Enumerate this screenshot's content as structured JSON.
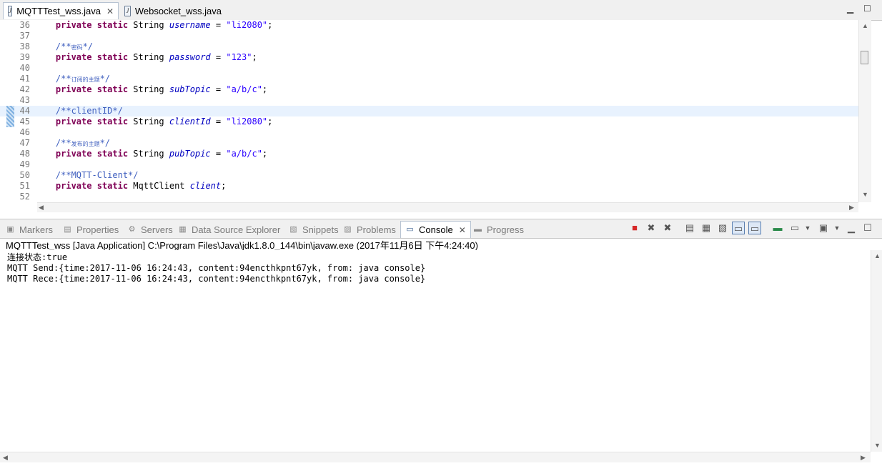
{
  "editor_tabs": [
    {
      "label": "MQTTTest_wss.java",
      "active": true,
      "closable": true
    },
    {
      "label": "Websocket_wss.java",
      "active": false,
      "closable": false
    }
  ],
  "code_lines": [
    {
      "num": "36",
      "segments": [
        {
          "t": "    ",
          "c": ""
        },
        {
          "t": "private static ",
          "c": "kw"
        },
        {
          "t": "String ",
          "c": ""
        },
        {
          "t": "username",
          "c": "fld"
        },
        {
          "t": " = ",
          "c": ""
        },
        {
          "t": "\"li2080\"",
          "c": "str"
        },
        {
          "t": ";",
          "c": ""
        }
      ]
    },
    {
      "num": "37",
      "segments": []
    },
    {
      "num": "38",
      "segments": [
        {
          "t": "    /**",
          "c": "cmt"
        },
        {
          "t": "密码",
          "c": "cmt cmtsmall"
        },
        {
          "t": "*/",
          "c": "cmt"
        }
      ]
    },
    {
      "num": "39",
      "segments": [
        {
          "t": "    ",
          "c": ""
        },
        {
          "t": "private static ",
          "c": "kw"
        },
        {
          "t": "String ",
          "c": ""
        },
        {
          "t": "password",
          "c": "fld"
        },
        {
          "t": " = ",
          "c": ""
        },
        {
          "t": "\"123\"",
          "c": "str"
        },
        {
          "t": ";",
          "c": ""
        }
      ]
    },
    {
      "num": "40",
      "segments": []
    },
    {
      "num": "41",
      "segments": [
        {
          "t": "    /**",
          "c": "cmt"
        },
        {
          "t": "订阅的主题",
          "c": "cmt cmtsmall"
        },
        {
          "t": "*/",
          "c": "cmt"
        }
      ]
    },
    {
      "num": "42",
      "segments": [
        {
          "t": "    ",
          "c": ""
        },
        {
          "t": "private static ",
          "c": "kw"
        },
        {
          "t": "String ",
          "c": ""
        },
        {
          "t": "subTopic",
          "c": "fld"
        },
        {
          "t": " = ",
          "c": ""
        },
        {
          "t": "\"a/b/c\"",
          "c": "str"
        },
        {
          "t": ";",
          "c": ""
        }
      ]
    },
    {
      "num": "43",
      "segments": []
    },
    {
      "num": "44",
      "segments": [
        {
          "t": "    /**clientID*/",
          "c": "cmt"
        }
      ],
      "current": true
    },
    {
      "num": "45",
      "segments": [
        {
          "t": "    ",
          "c": ""
        },
        {
          "t": "private static ",
          "c": "kw"
        },
        {
          "t": "String ",
          "c": ""
        },
        {
          "t": "clientId",
          "c": "fld"
        },
        {
          "t": " = ",
          "c": ""
        },
        {
          "t": "\"li2080\"",
          "c": "str"
        },
        {
          "t": ";",
          "c": ""
        }
      ]
    },
    {
      "num": "46",
      "segments": []
    },
    {
      "num": "47",
      "segments": [
        {
          "t": "    /**",
          "c": "cmt"
        },
        {
          "t": "发布的主题",
          "c": "cmt cmtsmall"
        },
        {
          "t": "*/",
          "c": "cmt"
        }
      ]
    },
    {
      "num": "48",
      "segments": [
        {
          "t": "    ",
          "c": ""
        },
        {
          "t": "private static ",
          "c": "kw"
        },
        {
          "t": "String ",
          "c": ""
        },
        {
          "t": "pubTopic",
          "c": "fld"
        },
        {
          "t": " = ",
          "c": ""
        },
        {
          "t": "\"a/b/c\"",
          "c": "str"
        },
        {
          "t": ";",
          "c": ""
        }
      ]
    },
    {
      "num": "49",
      "segments": []
    },
    {
      "num": "50",
      "segments": [
        {
          "t": "    /**MQTT-Client*/",
          "c": "cmt"
        }
      ]
    },
    {
      "num": "51",
      "segments": [
        {
          "t": "    ",
          "c": ""
        },
        {
          "t": "private static ",
          "c": "kw"
        },
        {
          "t": "MqttClient ",
          "c": ""
        },
        {
          "t": "client",
          "c": "fld"
        },
        {
          "t": ";",
          "c": ""
        }
      ]
    },
    {
      "num": "52",
      "segments": []
    }
  ],
  "view_tabs": [
    {
      "label": "Markers",
      "icon": "markers-icon",
      "glyph": "▣"
    },
    {
      "label": "Properties",
      "icon": "properties-icon",
      "glyph": "▤"
    },
    {
      "label": "Servers",
      "icon": "servers-icon",
      "glyph": "⚙"
    },
    {
      "label": "Data Source Explorer",
      "icon": "data-source-icon",
      "glyph": "▦"
    },
    {
      "label": "Snippets",
      "icon": "snippets-icon",
      "glyph": "▧"
    },
    {
      "label": "Problems",
      "icon": "problems-icon",
      "glyph": "▨"
    },
    {
      "label": "Console",
      "icon": "console-icon",
      "glyph": "▭",
      "active": true
    },
    {
      "label": "Progress",
      "icon": "progress-icon",
      "glyph": "▬"
    }
  ],
  "console": {
    "title": "MQTTTest_wss [Java Application] C:\\Program Files\\Java\\jdk1.8.0_144\\bin\\javaw.exe (2017年11月6日 下午4:24:40)",
    "lines": [
      "连接状态:true",
      "MQTT Send:{time:2017-11-06 16:24:43, content:94encthkpnt67yk, from: java console}",
      "MQTT Rece:{time:2017-11-06 16:24:43, content:94encthkpnt67yk, from: java console}"
    ]
  },
  "colors": {
    "keyword": "#7f0055",
    "field": "#0000c0",
    "string": "#2a00ff",
    "comment": "#3f5fbf",
    "current_line": "#e8f2fe"
  }
}
